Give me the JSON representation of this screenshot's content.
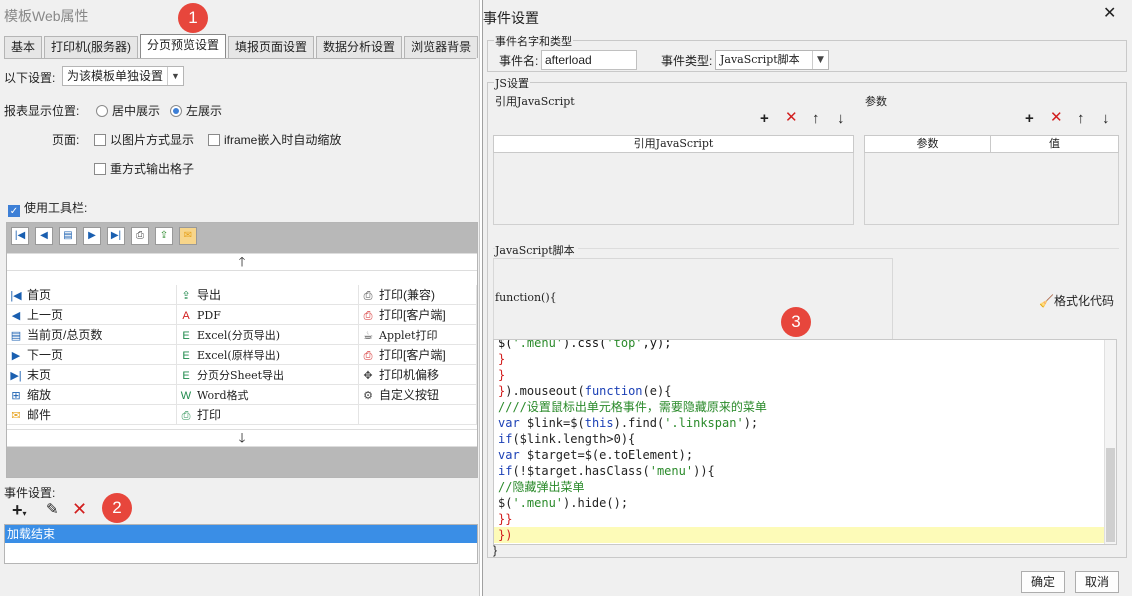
{
  "left_panel": {
    "title": "模板Web属性",
    "tabs": [
      "基本",
      "打印机(服务器)",
      "分页预览设置",
      "填报页面设置",
      "数据分析设置",
      "浏览器背景"
    ],
    "active_tab": "分页预览设置",
    "settings_label": "以下设置:",
    "settings_select": "为该模板单独设置",
    "position_label": "报表显示位置:",
    "position_options": [
      "居中展示",
      "左展示"
    ],
    "position_selected": "左展示",
    "page_label": "页面:",
    "page_options": [
      "以图片方式显示",
      "iframe嵌入时自动缩放",
      "重方式输出格子"
    ],
    "toolbar_label": "使用工具栏:",
    "toolbar_grid": [
      [
        "首页",
        "导出",
        "打印(兼容)"
      ],
      [
        "上一页",
        "PDF",
        "打印[客户端]"
      ],
      [
        "当前页/总页数",
        "Excel(分页导出)",
        "Applet打印"
      ],
      [
        "下一页",
        "Excel(原样导出)",
        "打印[客户端]"
      ],
      [
        "末页",
        "分页分Sheet导出",
        "打印机偏移"
      ],
      [
        "缩放",
        "Word格式",
        "自定义按钮"
      ],
      [
        "邮件",
        "打印",
        ""
      ]
    ],
    "events_label": "事件设置:",
    "event_items": [
      "加载结束"
    ]
  },
  "dialog": {
    "title": "事件设置",
    "section_name": "事件名字和类型",
    "event_name_label": "事件名:",
    "event_name_value": "afterload",
    "event_type_label": "事件类型:",
    "event_type_value": "JavaScript脚本",
    "js_section": "JS设置",
    "ref_js_label": "引用JavaScript",
    "ref_js_header": "引用JavaScript",
    "params_label": "参数",
    "params_headers": [
      "参数",
      "值"
    ],
    "script_label": "JavaScript脚本",
    "function_sig": "function(){",
    "format_code": "格式化代码",
    "code_lines": [
      {
        "t": "$('.menu').css('top',y);",
        "c": "blk"
      },
      {
        "t": "}",
        "c": "red"
      },
      {
        "t": "}",
        "c": "red"
      },
      {
        "t": "}).mouseout(function(e){",
        "c": "mix1"
      },
      {
        "t": "////设置鼠标出单元格事件，需要隐藏原来的菜单",
        "c": "cmt"
      },
      {
        "t": "var $link=$(this).find('.linkspan');",
        "c": "mix2"
      },
      {
        "t": "if($link.length>0){",
        "c": "mix3"
      },
      {
        "t": "var $target=$(e.toElement);",
        "c": "mix4"
      },
      {
        "t": "if(!$target.hasClass('menu')){",
        "c": "mix5"
      },
      {
        "t": "//隐藏弹出菜单",
        "c": "cmt"
      },
      {
        "t": "$('.menu').hide();",
        "c": "mix6"
      },
      {
        "t": "}}",
        "c": "red"
      },
      {
        "t": "})",
        "c": "red"
      }
    ],
    "closing_brace": "}",
    "ok": "确定",
    "cancel": "取消"
  },
  "badges": [
    "1",
    "2",
    "3"
  ],
  "colors": {
    "badge": "#e7463c",
    "selection": "#3a8ee6",
    "keyword": "#1a3fb5",
    "string": "#2a8a2a",
    "brace": "#d21e1e",
    "highlight": "#fdfbb8"
  }
}
